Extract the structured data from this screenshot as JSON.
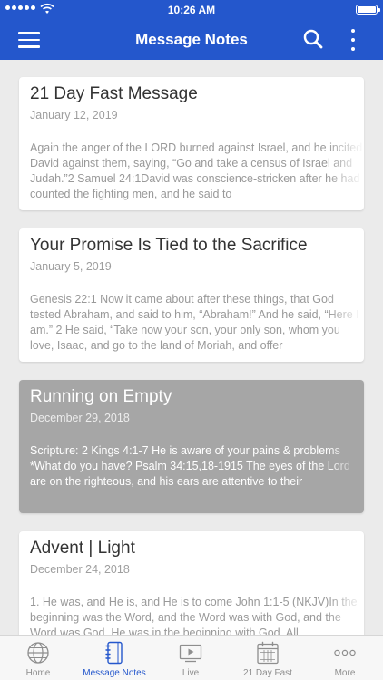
{
  "status_bar": {
    "time": "10:26 AM"
  },
  "header": {
    "title": "Message Notes"
  },
  "messages": [
    {
      "title": "21 Day Fast Message",
      "date": "January 12, 2019",
      "excerpt": "Again the anger of the LORD burned against Israel, and he incited David against them, saying, “Go and take a census of Israel and Judah.”2 Samuel 24:1David was conscience-stricken after he had counted the fighting men, and he said to"
    },
    {
      "title": "Your Promise Is Tied to the Sacrifice",
      "date": "January 5, 2019",
      "excerpt": "Genesis 22:1 Now it came about after these things, that God tested Abraham, and said to him, “Abraham!” And he said, “Here I am.” 2 He said, “Take now your son, your only son, whom you love, Isaac, and go to the land of Moriah, and offer"
    },
    {
      "title": "Running on Empty",
      "date": "December 29, 2018",
      "excerpt": "Scripture: 2 Kings 4:1-7 He is aware of your pains & problems *What do you have? Psalm 34:15,18-1915 The eyes of the Lord are on the righteous,      and his ears are attentive to their"
    },
    {
      "title": "Advent | Light",
      "date": "December 24, 2018",
      "excerpt": "1. He was, and He is, and He is to come John 1:1-5 (NKJV)In the beginning was the Word, and the Word was with God, and the Word was God.  He was in the beginning with God.  All"
    }
  ],
  "tabs": [
    {
      "label": "Home",
      "icon": "globe-icon"
    },
    {
      "label": "Message Notes",
      "icon": "notebook-icon"
    },
    {
      "label": "Live",
      "icon": "video-play-icon"
    },
    {
      "label": "21 Day Fast",
      "icon": "calendar-icon"
    },
    {
      "label": "More",
      "icon": "ellipsis-icon"
    }
  ],
  "colors": {
    "primary": "#2457cc",
    "selected_card": "#a6a6a6",
    "tab_inactive": "#8e8e8e"
  }
}
